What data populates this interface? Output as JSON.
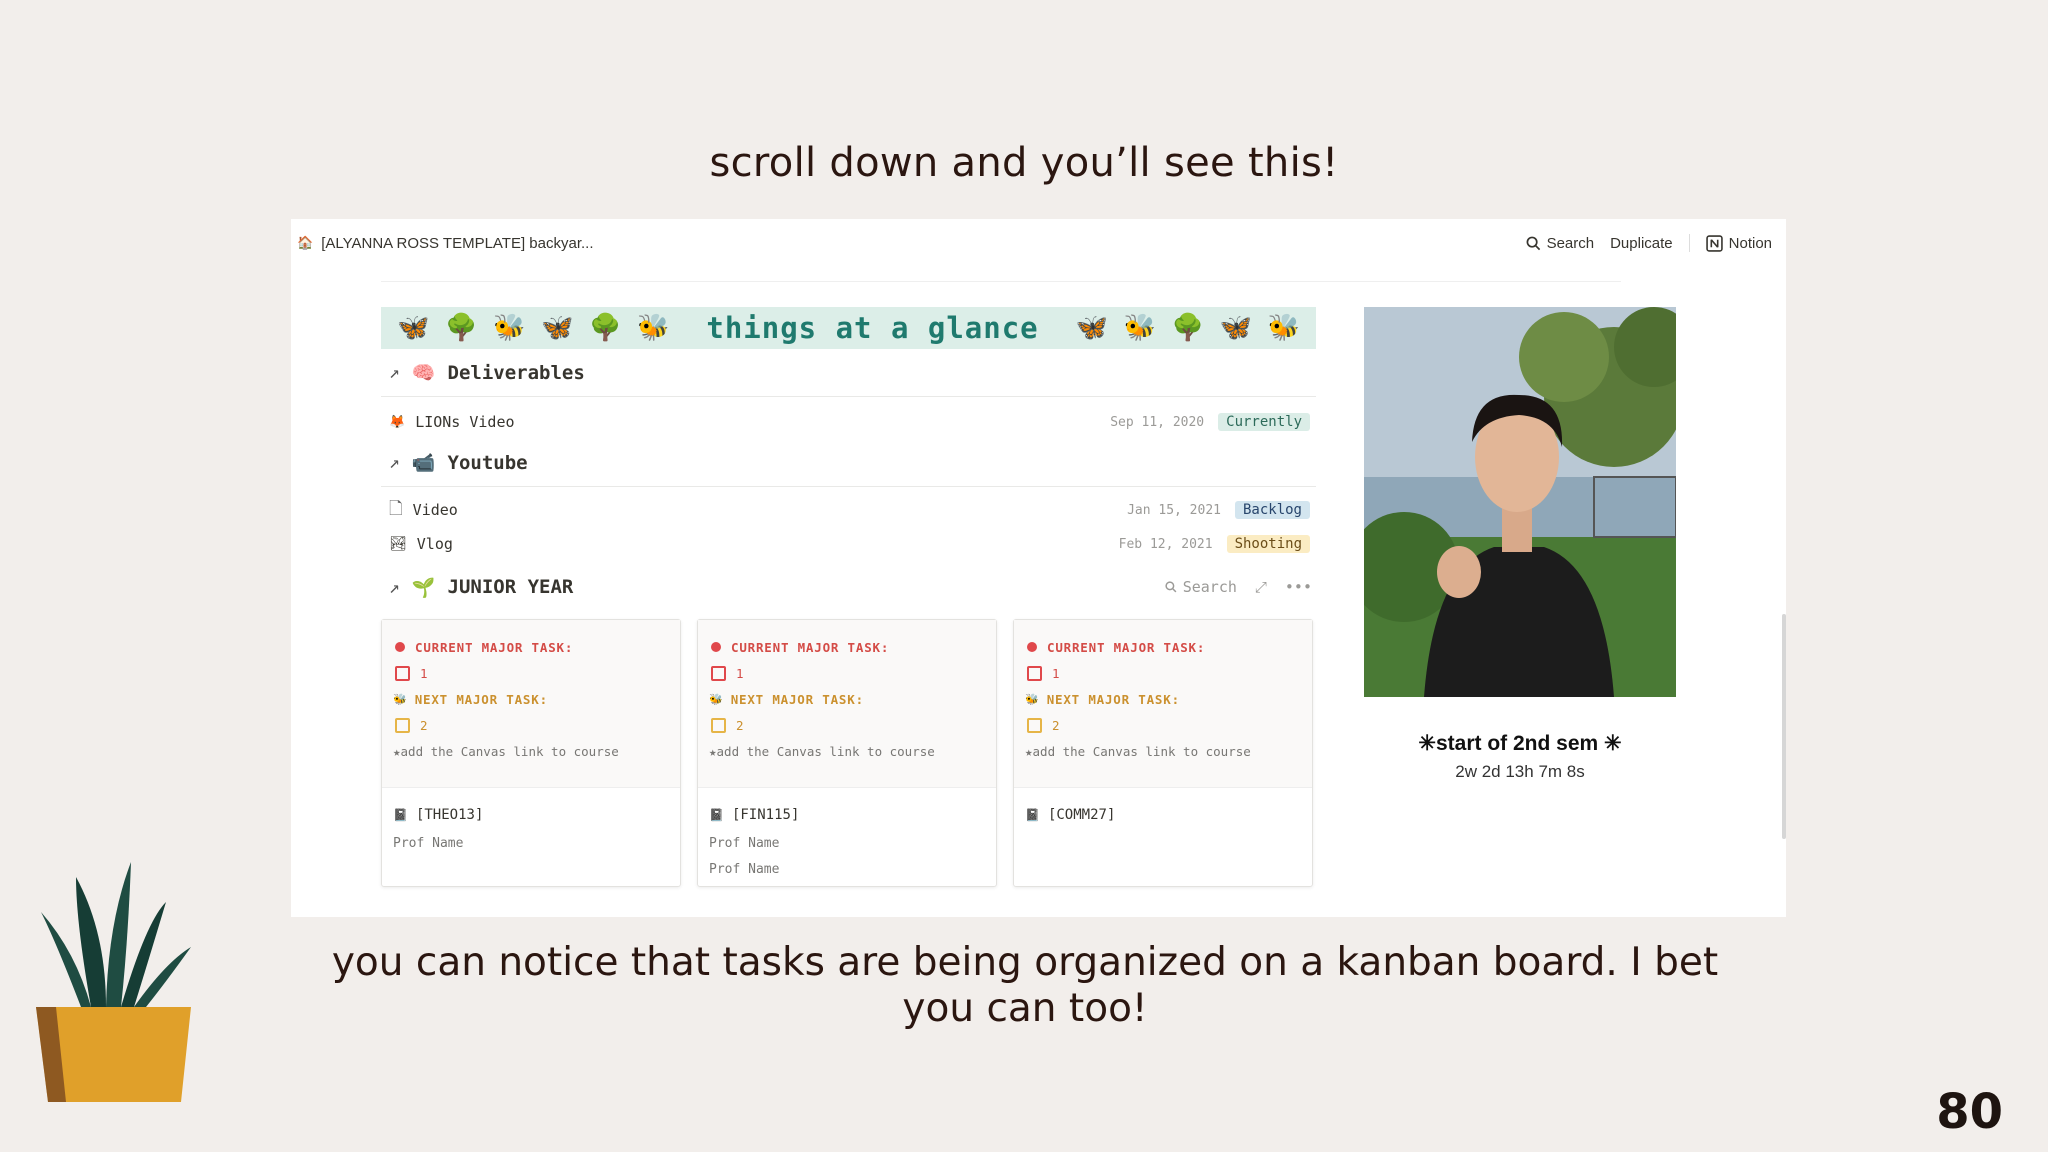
{
  "slide": {
    "title": "scroll down and you’ll see this!",
    "caption": "you can notice that tasks are being organized on a kanban board. I bet you can too!",
    "page_number": "80"
  },
  "topbar": {
    "page_title": "[ALYANNA ROSS TEMPLATE] backyar...",
    "search_label": "Search",
    "duplicate_label": "Duplicate",
    "notion_label": "Notion"
  },
  "banner": {
    "left_icons": "🦋 🌳 🐝 🦋 🌳 🐝",
    "title": "things at a glance",
    "right_icons": "🦋 🐝 🌳 🦋 🐝"
  },
  "deliverables": {
    "icon": "🧠",
    "title": "Deliverables",
    "items": [
      {
        "icon": "🦊",
        "name": "LIONs Video",
        "date": "Sep 11, 2020",
        "status": "Currently"
      }
    ]
  },
  "youtube": {
    "icon": "📹",
    "title": "Youtube",
    "items": [
      {
        "icon": "🗋",
        "name": "Video",
        "date": "Jan 15, 2021",
        "status": "Backlog"
      },
      {
        "icon": "🏞",
        "name": "Vlog",
        "date": "Feb 12, 2021",
        "status": "Shooting"
      }
    ]
  },
  "junior_year": {
    "icon": "🌱",
    "title": "JUNIOR YEAR",
    "search_label": "Search",
    "cards": [
      {
        "current_label": "CURRENT MAJOR TASK:",
        "current_num": "1",
        "next_label": "NEXT MAJOR TASK:",
        "next_num": "2",
        "note": "★add the Canvas link to course",
        "code": "[THEO13]",
        "profs": [
          "Prof Name"
        ]
      },
      {
        "current_label": "CURRENT MAJOR TASK:",
        "current_num": "1",
        "next_label": "NEXT MAJOR TASK:",
        "next_num": "2",
        "note": "★add the Canvas link to course",
        "code": "[FIN115]",
        "profs": [
          "Prof Name",
          "Prof Name"
        ]
      },
      {
        "current_label": "CURRENT MAJOR TASK:",
        "current_num": "1",
        "next_label": "NEXT MAJOR TASK:",
        "next_num": "2",
        "note": "★add the Canvas link to course",
        "code": "[COMM27]",
        "profs": []
      }
    ]
  },
  "countdown": {
    "title": "start of 2nd sem",
    "value": "2w 2d 13h 7m 8s"
  }
}
